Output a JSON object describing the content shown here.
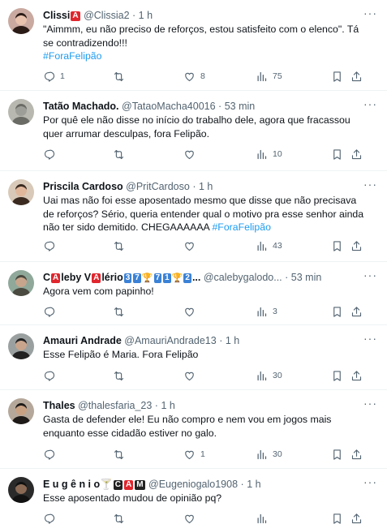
{
  "tweets": [
    {
      "name": "Clissi",
      "badges": [
        {
          "text": "A",
          "kind": "red"
        }
      ],
      "handle": "@Clissia2",
      "time": "1 h",
      "text_parts": [
        "\"Aimmm, eu não preciso de reforços, estou satisfeito com o elenco\".  Tá se contradizendo!!!\n",
        "#ForaFelipão"
      ],
      "stats": {
        "replies": "1",
        "retweets": "",
        "likes": "8",
        "views": "75"
      },
      "avatar_colors": {
        "bg": "#c9a9a0",
        "hair": "#2b1b16",
        "skin": "#e8c2ad"
      }
    },
    {
      "name": "Tatão Machado.",
      "badges": [],
      "handle": "@TataoMacha40016",
      "time": "53 min",
      "text_parts": [
        "Por quê ele não disse no início do trabalho dele,  agora que fracassou  quer arrumar desculpas,  fora Felipão.",
        ""
      ],
      "stats": {
        "replies": "",
        "retweets": "",
        "likes": "",
        "views": "10"
      },
      "avatar_colors": {
        "bg": "#b8b8b0",
        "hair": "#6b6b66",
        "skin": "#9e9e98"
      }
    },
    {
      "name": "Priscila Cardoso",
      "badges": [],
      "handle": "@PritCardoso",
      "time": "1 h",
      "text_parts": [
        "Uai mas não foi esse aposentado mesmo que disse que não precisava de reforços? Sério, queria entender qual o motivo pra esse senhor ainda não ter sido demitido. CHEGAAAAAA ",
        "#ForaFelipão"
      ],
      "stats": {
        "replies": "",
        "retweets": "",
        "likes": "",
        "views": "43"
      },
      "avatar_colors": {
        "bg": "#d8c9b8",
        "hair": "#3a2a20",
        "skin": "#e1b79c"
      }
    },
    {
      "name": "C",
      "badges": [
        {
          "text": "A",
          "kind": "red"
        },
        {
          "text": "leby V",
          "kind": "plain"
        },
        {
          "text": "A",
          "kind": "red"
        },
        {
          "text": "lério",
          "kind": "plain"
        },
        {
          "text": "3",
          "kind": "blue"
        },
        {
          "text": "7",
          "kind": "blue"
        },
        {
          "text": "🏆",
          "kind": "trophy"
        },
        {
          "text": "7",
          "kind": "blue"
        },
        {
          "text": "1",
          "kind": "blue"
        },
        {
          "text": "🏆",
          "kind": "trophy"
        },
        {
          "text": "2",
          "kind": "blue"
        },
        {
          "text": "...",
          "kind": "plain"
        }
      ],
      "handle": "@calebygalodo...",
      "time": "53 min",
      "text_parts": [
        "Agora vem com papinho!",
        ""
      ],
      "stats": {
        "replies": "",
        "retweets": "",
        "likes": "",
        "views": "3"
      },
      "avatar_colors": {
        "bg": "#8fa89a",
        "hair": "#4a4a40",
        "skin": "#c7a58c"
      }
    },
    {
      "name": "Amauri Andrade",
      "badges": [],
      "handle": "@AmauriAndrade13",
      "time": "1 h",
      "text_parts": [
        "Esse Felipão é Maria. Fora Felipão",
        ""
      ],
      "stats": {
        "replies": "",
        "retweets": "",
        "likes": "",
        "views": "30"
      },
      "avatar_colors": {
        "bg": "#9aa0a0",
        "hair": "#222222",
        "skin": "#c9a48c"
      }
    },
    {
      "name": "Thales",
      "badges": [],
      "handle": "@thalesfaria_23",
      "time": "1 h",
      "text_parts": [
        "Gasta de defender ele! Eu não compro e nem vou em jogos mais enquanto esse cidadão estiver no galo.",
        ""
      ],
      "stats": {
        "replies": "",
        "retweets": "",
        "likes": "1",
        "views": "30"
      },
      "avatar_colors": {
        "bg": "#b5a89a",
        "hair": "#1d1a18",
        "skin": "#c8a183"
      }
    },
    {
      "name": "E u g ê n i o",
      "badges": [
        {
          "text": "🍸",
          "kind": "plain"
        },
        {
          "text": "C",
          "kind": "black"
        },
        {
          "text": "A",
          "kind": "red"
        },
        {
          "text": "M",
          "kind": "black"
        }
      ],
      "handle": "@Eugeniogalo1908",
      "time": "1 h",
      "text_parts": [
        "Esse aposentado mudou de opinião pq?",
        ""
      ],
      "stats": {
        "replies": "",
        "retweets": "",
        "likes": "",
        "views": ""
      },
      "avatar_colors": {
        "bg": "#2a2a2a",
        "hair": "#111111",
        "skin": "#8a6a55"
      }
    }
  ],
  "icons": {
    "reply": "reply-icon",
    "retweet": "retweet-icon",
    "like": "heart-icon",
    "views": "views-icon",
    "bookmark": "bookmark-icon",
    "share": "share-icon",
    "more": "more-icon"
  },
  "more_glyph": "···",
  "colors": {
    "hashtag": "#1d9bf0",
    "muted": "#536471",
    "divider": "#eff3f4"
  }
}
